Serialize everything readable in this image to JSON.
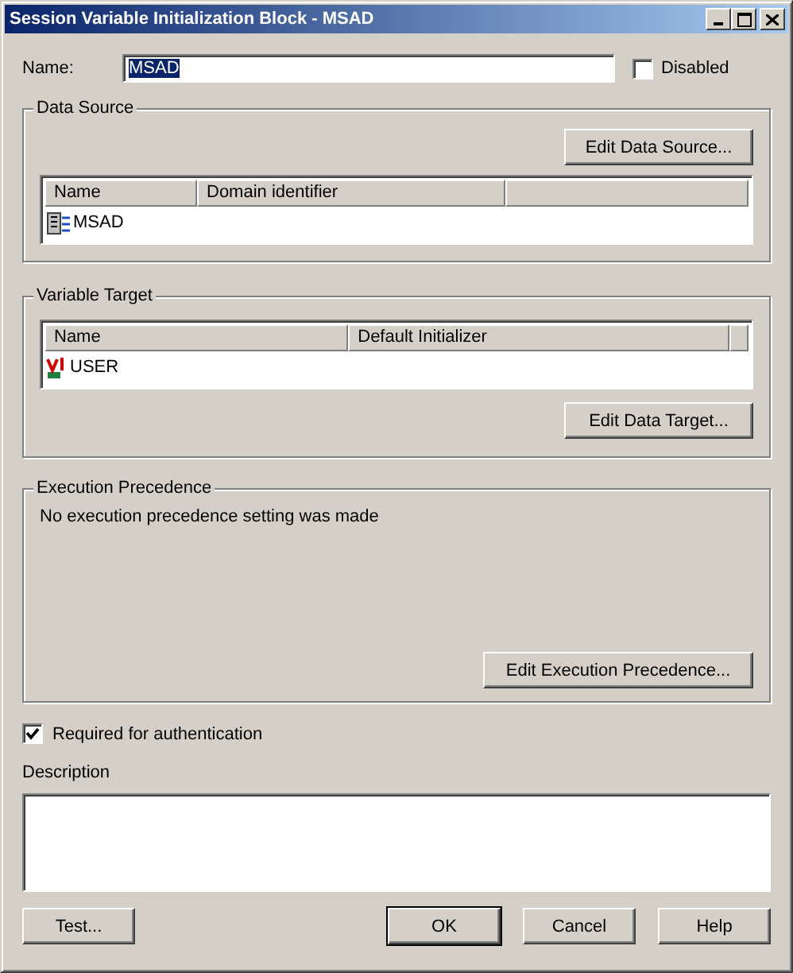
{
  "window": {
    "title": "Session Variable Initialization Block - MSAD"
  },
  "name_field": {
    "label": "Name:",
    "value": "MSAD",
    "text_selected": true
  },
  "disabled": {
    "label": "Disabled",
    "checked": false
  },
  "data_source": {
    "title": "Data Source",
    "button": "Edit Data Source...",
    "columns": [
      "Name",
      "Domain identifier"
    ],
    "rows": [
      {
        "name": "MSAD"
      }
    ]
  },
  "variable_target": {
    "title": "Variable Target",
    "button": "Edit Data Target...",
    "columns": [
      "Name",
      "Default Initializer"
    ],
    "rows": [
      {
        "name": "USER"
      }
    ]
  },
  "execution_precedence": {
    "title": "Execution Precedence",
    "message": "No execution precedence setting was made",
    "button": "Edit Execution Precedence..."
  },
  "required_for_authentication": {
    "label": "Required for authentication",
    "checked": true
  },
  "description": {
    "label": "Description"
  },
  "buttons": [
    {
      "label": "Test...",
      "kind": "left"
    },
    {
      "label": "OK",
      "kind": "default"
    },
    {
      "label": "Cancel",
      "kind": "normal"
    },
    {
      "label": "Help",
      "kind": "normal"
    }
  ]
}
